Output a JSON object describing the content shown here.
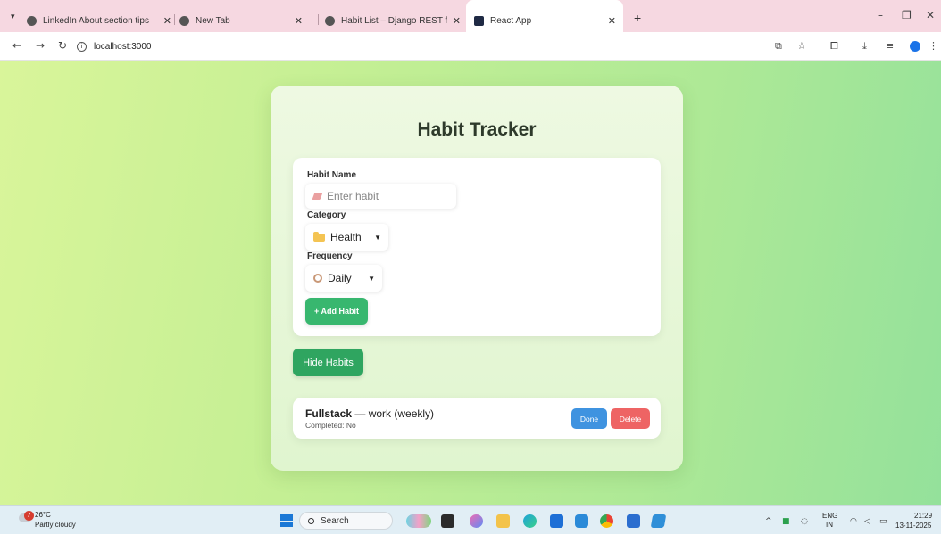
{
  "browser": {
    "tabs": [
      {
        "title": "LinkedIn About section tips",
        "close": "✕"
      },
      {
        "title": "New Tab",
        "close": "✕"
      },
      {
        "title": "Habit List – Django REST framew",
        "close": "✕"
      },
      {
        "title": "React App",
        "close": "✕"
      }
    ],
    "new_tab": "+",
    "url": "localhost:3000",
    "window_controls": {
      "minimize": "–",
      "restore": "❐",
      "close": "✕"
    }
  },
  "app": {
    "title": "Habit Tracker",
    "form": {
      "habit_name_label": "Habit Name",
      "habit_name_placeholder": "Enter habit",
      "habit_name_value": "",
      "category_label": "Category",
      "category_value": "Health",
      "frequency_label": "Frequency",
      "frequency_value": "Daily",
      "add_button": "+ Add Habit"
    },
    "toggle_button": "Hide Habits",
    "habits": [
      {
        "name": "Fullstack",
        "detail": " — work (weekly)",
        "status": "Completed: No",
        "done": "Done",
        "delete": "Delete"
      }
    ],
    "colors": {
      "add": "#38b76f",
      "hide": "#2fa560",
      "done": "#3f93e0",
      "delete": "#ee6464"
    }
  },
  "taskbar": {
    "weather_badge": "7",
    "temperature": "26°C",
    "condition": "Partly cloudy",
    "search": "Search",
    "lang_top": "ENG",
    "lang_bottom": "IN",
    "time": "21:29",
    "date": "13-11-2025"
  }
}
